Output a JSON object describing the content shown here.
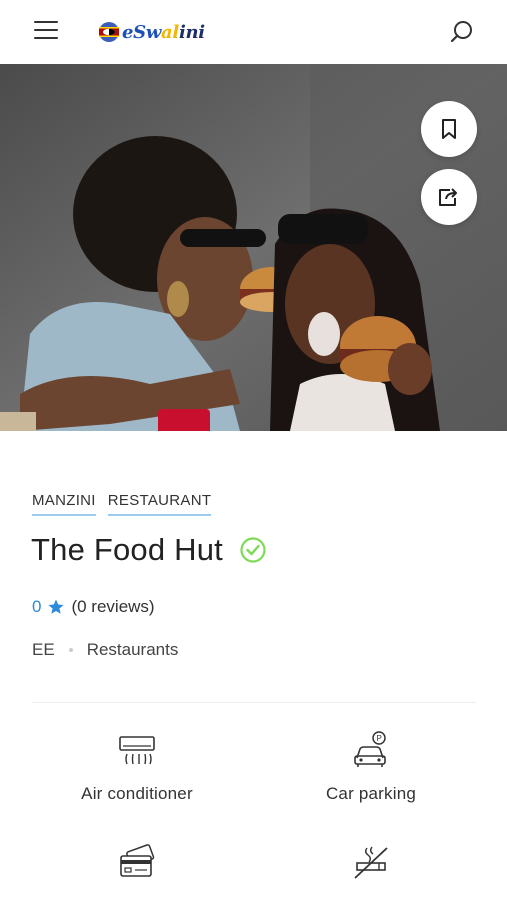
{
  "header": {
    "logo": {
      "part1": "eSw",
      "part2": "al",
      "part3": "ini"
    },
    "menu_icon": "hamburger-icon",
    "search_icon": "search-icon"
  },
  "hero": {
    "image_description": "photo",
    "bookmark_icon": "bookmark-icon",
    "share_icon": "share-icon"
  },
  "listing": {
    "tags": [
      "MANZINI",
      "RESTAURANT"
    ],
    "title": "The Food Hut",
    "verified_icon": "check-circle-icon",
    "rating": {
      "value": "0",
      "reviews": "(0 reviews)"
    },
    "meta": {
      "price": "EE",
      "category": "Restaurants"
    }
  },
  "amenities": [
    {
      "label": "Air conditioner",
      "icon": "air-conditioner-icon"
    },
    {
      "label": "Car parking",
      "icon": "car-parking-icon"
    },
    {
      "label": "",
      "icon": "credit-card-icon"
    },
    {
      "label": "",
      "icon": "no-smoking-icon"
    }
  ],
  "colors": {
    "accent_blue": "#2d8ad8",
    "verified_green": "#7ed957",
    "tag_underline": "#9ccbee"
  }
}
